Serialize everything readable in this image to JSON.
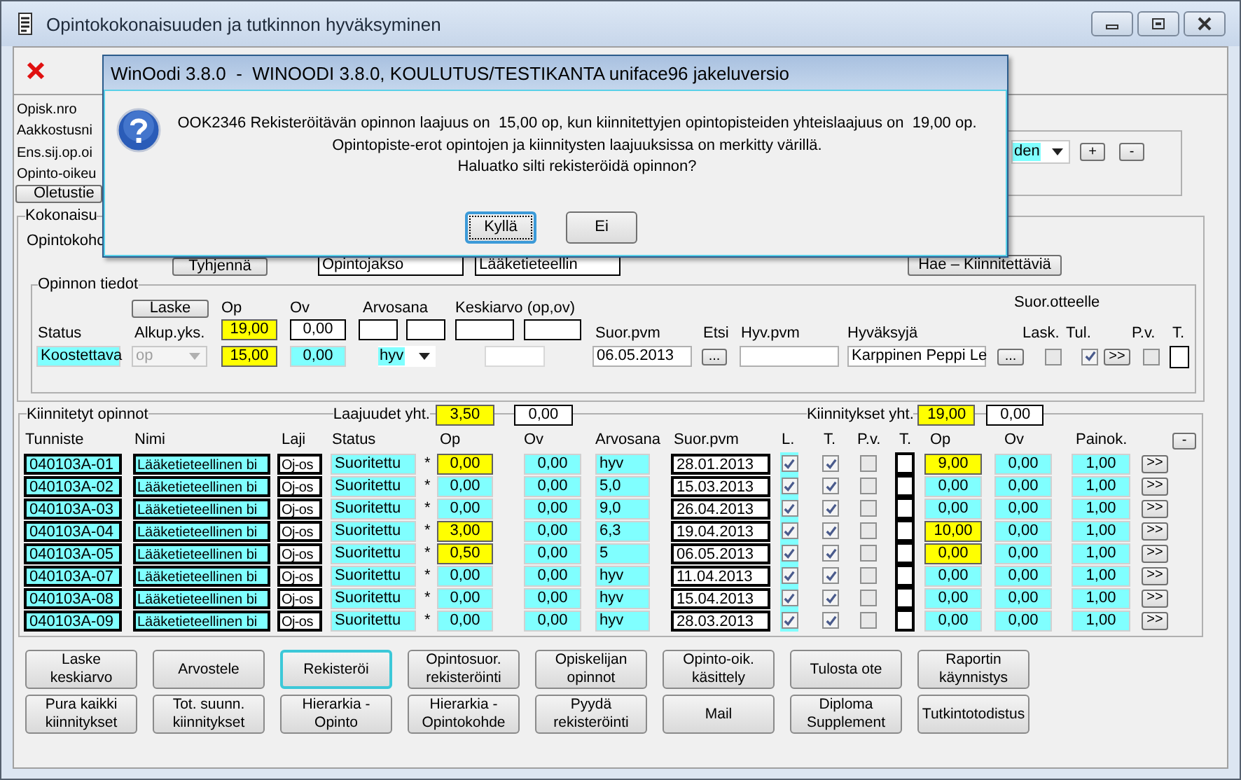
{
  "window": {
    "title": "Opintokokonaisuuden ja tutkinnon hyväksyminen"
  },
  "student_labels": [
    "Opisk.nro",
    "Aakkostusni",
    "Ens.sij.op.oi",
    "Opinto-oikeu"
  ],
  "defaults_button": "Oletustie",
  "language_select": {
    "value": "den"
  },
  "row_buttons": [
    "+",
    "-"
  ],
  "kokonaisuus": {
    "legend": "Kokonaisu",
    "target_label": "Opintokohc",
    "clear_button": "Tyhjennä",
    "type_value": "Opintojakso",
    "name_value": "Lääketieteellin",
    "fetch_button": "Hae – Kiinnitettäviä"
  },
  "study_info": {
    "legend": "Opinnon tiedot",
    "calc_button": "Laske",
    "headers": {
      "op": "Op",
      "ov": "Ov",
      "grade": "Arvosana",
      "average": "Keskiarvo (op,ov)",
      "transcript": "Suor.otteelle",
      "status": "Status",
      "unit": "Alkup.yks.",
      "date": "Suor.pvm",
      "search": "Etsi",
      "approval_date": "Hyv.pvm",
      "approver": "Hyväksyjä",
      "calc": "Lask.",
      "tul": "Tul.",
      "pv": "P.v.",
      "t": "T."
    },
    "op_total": {
      "value": "19,00",
      "highlighted": true
    },
    "ov_total": {
      "value": "0,00",
      "highlighted": false
    },
    "status": "Koostettava",
    "unit": {
      "value": "op",
      "disabled": true
    },
    "op": {
      "value": "15,00",
      "highlighted": true
    },
    "ov": {
      "value": "0,00",
      "highlighted": false
    },
    "grade": "hyv",
    "date": "06.05.2013",
    "date_button": "...",
    "approver": "Karppinen Peppi Le",
    "approver_button": "...",
    "calc_checked": false,
    "tul_checked": true,
    "move_button": ">>",
    "pv_checked": false
  },
  "linked": {
    "legend": "Kiinnitetyt opinnot",
    "sum_label": "Laajuudet yht.",
    "sum_op": {
      "value": "3,50",
      "highlighted": true
    },
    "sum_ov": "0,00",
    "links_label": "Kiinnitykset yht.",
    "links_op": {
      "value": "19,00",
      "highlighted": true
    },
    "links_ov": "0,00",
    "columns": [
      "Tunniste",
      "Nimi",
      "Laji",
      "Status",
      "Op",
      "Ov",
      "Arvosana",
      "Suor.pvm",
      "L.",
      "T.",
      "P.v.",
      "T.",
      "Op",
      "Ov",
      "Painok."
    ],
    "collapse_button": "-",
    "rows": [
      {
        "id": "040103A-01",
        "name": "Lääketieteellinen bi",
        "type": "Oj-os",
        "status": "Suoritettu",
        "mark": "*",
        "op": "0,00",
        "op_highlighted": true,
        "ov": "0,00",
        "grade": "hyv",
        "date": "28.01.2013",
        "l_checked": true,
        "t_checked": true,
        "pv_checked": false,
        "link_op": "9,00",
        "link_op_highlighted": true,
        "link_ov": "0,00",
        "weight": "1,00",
        "open_button": ">>"
      },
      {
        "id": "040103A-02",
        "name": "Lääketieteellinen bi",
        "type": "Oj-os",
        "status": "Suoritettu",
        "mark": "*",
        "op": "0,00",
        "op_highlighted": false,
        "ov": "0,00",
        "grade": "5,0",
        "date": "15.03.2013",
        "l_checked": true,
        "t_checked": true,
        "pv_checked": false,
        "link_op": "0,00",
        "link_op_highlighted": false,
        "link_ov": "0,00",
        "weight": "1,00",
        "open_button": ">>"
      },
      {
        "id": "040103A-03",
        "name": "Lääketieteellinen bi",
        "type": "Oj-os",
        "status": "Suoritettu",
        "mark": "*",
        "op": "0,00",
        "op_highlighted": false,
        "ov": "0,00",
        "grade": "9,0",
        "date": "26.04.2013",
        "l_checked": true,
        "t_checked": true,
        "pv_checked": false,
        "link_op": "0,00",
        "link_op_highlighted": false,
        "link_ov": "0,00",
        "weight": "1,00",
        "open_button": ">>"
      },
      {
        "id": "040103A-04",
        "name": "Lääketieteellinen bi",
        "type": "Oj-os",
        "status": "Suoritettu",
        "mark": "*",
        "op": "3,00",
        "op_highlighted": true,
        "ov": "0,00",
        "grade": "6,3",
        "date": "19.04.2013",
        "l_checked": true,
        "t_checked": true,
        "pv_checked": false,
        "link_op": "10,00",
        "link_op_highlighted": true,
        "link_ov": "0,00",
        "weight": "1,00",
        "open_button": ">>"
      },
      {
        "id": "040103A-05",
        "name": "Lääketieteellinen bi",
        "type": "Oj-os",
        "status": "Suoritettu",
        "mark": "*",
        "op": "0,50",
        "op_highlighted": true,
        "ov": "0,00",
        "grade": "5",
        "date": "06.05.2013",
        "l_checked": true,
        "t_checked": true,
        "pv_checked": false,
        "link_op": "0,00",
        "link_op_highlighted": true,
        "link_ov": "0,00",
        "weight": "1,00",
        "open_button": ">>"
      },
      {
        "id": "040103A-07",
        "name": "Lääketieteellinen bi",
        "type": "Oj-os",
        "status": "Suoritettu",
        "mark": "*",
        "op": "0,00",
        "op_highlighted": false,
        "ov": "0,00",
        "grade": "hyv",
        "date": "11.04.2013",
        "l_checked": true,
        "t_checked": true,
        "pv_checked": false,
        "link_op": "0,00",
        "link_op_highlighted": false,
        "link_ov": "0,00",
        "weight": "1,00",
        "open_button": ">>"
      },
      {
        "id": "040103A-08",
        "name": "Lääketieteellinen bi",
        "type": "Oj-os",
        "status": "Suoritettu",
        "mark": "*",
        "op": "0,00",
        "op_highlighted": false,
        "ov": "0,00",
        "grade": "hyv",
        "date": "15.04.2013",
        "l_checked": true,
        "t_checked": true,
        "pv_checked": false,
        "link_op": "0,00",
        "link_op_highlighted": false,
        "link_ov": "0,00",
        "weight": "1,00",
        "open_button": ">>"
      },
      {
        "id": "040103A-09",
        "name": "Lääketieteellinen bi",
        "type": "Oj-os",
        "status": "Suoritettu",
        "mark": "*",
        "op": "0,00",
        "op_highlighted": false,
        "ov": "0,00",
        "grade": "hyv",
        "date": "28.03.2013",
        "l_checked": true,
        "t_checked": true,
        "pv_checked": false,
        "link_op": "0,00",
        "link_op_highlighted": false,
        "link_ov": "0,00",
        "weight": "1,00",
        "open_button": ">>"
      }
    ]
  },
  "actions": [
    {
      "label": "Laske\nkeskiarvo",
      "focused": false
    },
    {
      "label": "Arvostele",
      "focused": false
    },
    {
      "label": "Rekisteröi",
      "focused": true
    },
    {
      "label": "Opintosuor.\nrekisteröinti",
      "focused": false
    },
    {
      "label": "Opiskelijan\nopinnot",
      "focused": false
    },
    {
      "label": "Opinto-oik.\nkäsittely",
      "focused": false
    },
    {
      "label": "Tulosta ote",
      "focused": false
    },
    {
      "label": "Raportin\nkäynnistys",
      "focused": false
    },
    {
      "label": "Pura kaikki\nkiinnitykset",
      "focused": false
    },
    {
      "label": "Tot. suunn.\nkiinnitykset",
      "focused": false
    },
    {
      "label": "Hierarkia -\nOpinto",
      "focused": false
    },
    {
      "label": "Hierarkia -\nOpintokohde",
      "focused": false
    },
    {
      "label": "Pyydä\nrekisteröinti",
      "focused": false
    },
    {
      "label": "Mail",
      "focused": false
    },
    {
      "label": "Diploma\nSupplement",
      "focused": false
    },
    {
      "label": "Tutkintotodistus",
      "focused": false
    }
  ],
  "dialog": {
    "title": "WinOodi 3.8.0  -  WINOODI 3.8.0, KOULUTUS/TESTIKANTA uniface96 jakeluversio",
    "lines": [
      "OOK2346 Rekisteröitävän opinnon laajuus on  15,00 op, kun kiinnitettyjen opintopisteiden yhteislaajuus on  19,00 op.",
      "Opintopiste-erot opintojen ja kiinnitysten laajuuksissa on merkitty värillä.",
      "Haluatko silti rekisteröidä opinnon?"
    ],
    "buttons": [
      {
        "label": "Kyllä",
        "focused": true
      },
      {
        "label": "Ei",
        "focused": false
      }
    ]
  }
}
